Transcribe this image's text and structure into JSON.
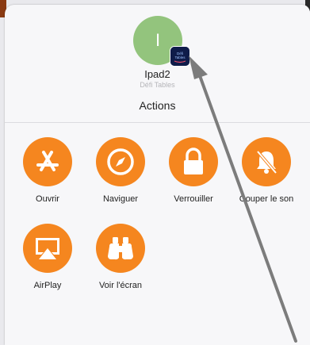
{
  "device": {
    "avatar_initial": "I",
    "name": "Ipad2",
    "app_name": "Défi Tables",
    "badge_text_line1": "Défi",
    "badge_text_line2": "Tables"
  },
  "section_title": "Actions",
  "actions": [
    {
      "label": "Ouvrir",
      "icon": "app-store-icon"
    },
    {
      "label": "Naviguer",
      "icon": "compass-icon"
    },
    {
      "label": "Verrouiller",
      "icon": "lock-icon"
    },
    {
      "label": "Couper le son",
      "icon": "bell-slash-icon"
    },
    {
      "label": "AirPlay",
      "icon": "airplay-icon"
    },
    {
      "label": "Voir l'écran",
      "icon": "binoculars-icon"
    }
  ],
  "colors": {
    "accent": "#f5861f",
    "avatar": "#93c47d",
    "background": "#f7f7f9",
    "arrow": "#7c7c7c"
  }
}
